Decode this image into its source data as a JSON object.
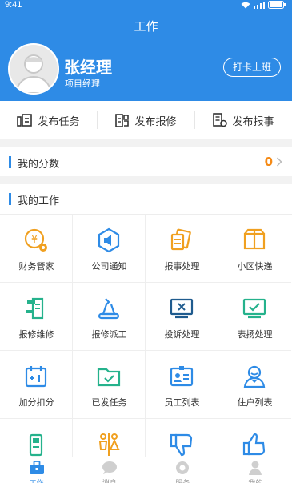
{
  "status": {
    "time": "9:41"
  },
  "header": {
    "title": "工作"
  },
  "user": {
    "name": "张经理",
    "role": "项目经理",
    "clock_in": "打卡上班"
  },
  "actions": [
    {
      "label": "发布任务",
      "icon": "task-publish-icon"
    },
    {
      "label": "发布报修",
      "icon": "repair-publish-icon"
    },
    {
      "label": "发布报事",
      "icon": "report-publish-icon"
    }
  ],
  "score": {
    "label": "我的分数",
    "value": "0"
  },
  "work": {
    "title": "我的工作",
    "items": [
      {
        "label": "财务管家",
        "icon": "finance-icon"
      },
      {
        "label": "公司通知",
        "icon": "notice-icon"
      },
      {
        "label": "报事处理",
        "icon": "report-handle-icon"
      },
      {
        "label": "小区快递",
        "icon": "parcel-icon"
      },
      {
        "label": "报修维修",
        "icon": "repair-icon"
      },
      {
        "label": "报修派工",
        "icon": "dispatch-icon"
      },
      {
        "label": "投诉处理",
        "icon": "complaint-icon"
      },
      {
        "label": "表扬处理",
        "icon": "praise-icon"
      },
      {
        "label": "加分扣分",
        "icon": "points-icon"
      },
      {
        "label": "已发任务",
        "icon": "sent-task-icon"
      },
      {
        "label": "员工列表",
        "icon": "staff-list-icon"
      },
      {
        "label": "住户列表",
        "icon": "resident-list-icon"
      },
      {
        "label": "",
        "icon": "device-icon"
      },
      {
        "label": "",
        "icon": "toilet-icon"
      },
      {
        "label": "",
        "icon": "thumbs-down-icon"
      },
      {
        "label": "",
        "icon": "thumbs-up-icon"
      }
    ]
  },
  "tabs": [
    {
      "label": "工作",
      "icon": "briefcase-icon",
      "active": true
    },
    {
      "label": "消息",
      "icon": "chat-icon"
    },
    {
      "label": "服务",
      "icon": "service-icon"
    },
    {
      "label": "我的",
      "icon": "person-icon"
    }
  ],
  "colors": {
    "primary": "#2e8be6",
    "accent": "#f58a16",
    "green": "#25b28c",
    "orange": "#f0a020"
  }
}
